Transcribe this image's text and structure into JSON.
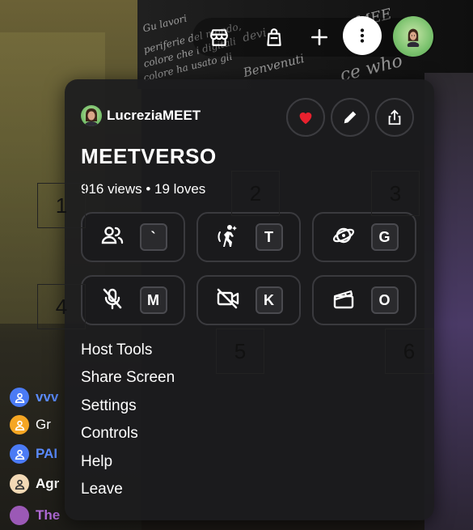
{
  "world": {
    "wall_lines": [
      "Gu lavori",
      "periferie del mondo,",
      "colore che i digitali",
      "colore ha usato gli",
      "devi",
      "Benvenuti",
      "MEE",
      "ce who"
    ]
  },
  "toolbar": {
    "items": [
      {
        "name": "store",
        "icon": "store-icon"
      },
      {
        "name": "bag",
        "icon": "bag-icon"
      },
      {
        "name": "create",
        "icon": "plus-icon"
      },
      {
        "name": "more",
        "icon": "more-vertical-icon"
      },
      {
        "name": "avatar",
        "icon": "user-avatar"
      }
    ]
  },
  "chat": [
    {
      "name": "vvv",
      "color": "#4b7bf5",
      "text_color": "#5b8cff"
    },
    {
      "name": "Gr",
      "color": "#f5a623",
      "text_color": "#ffffff"
    },
    {
      "name": "PAI",
      "color": "#4b7bf5",
      "text_color": "#5b8cff"
    },
    {
      "name": "Agr",
      "color": "#f3d9b5",
      "text_color": "#ffffff"
    },
    {
      "name": "The",
      "color": "#9b59b6",
      "text_color": "#b06ad6"
    }
  ],
  "panel": {
    "author": "LucreziaMEET",
    "title": "MEETVERSO",
    "stats": "916 views • 19 loves",
    "actions": [
      {
        "name": "love",
        "icon": "heart-icon",
        "color": "#e8212e"
      },
      {
        "name": "edit",
        "icon": "pencil-icon"
      },
      {
        "name": "share",
        "icon": "share-icon"
      }
    ],
    "controls": [
      {
        "name": "people",
        "icon": "people-icon",
        "key": "`"
      },
      {
        "name": "emote",
        "icon": "dance-icon",
        "key": "T"
      },
      {
        "name": "teleport",
        "icon": "orbit-icon",
        "key": "G"
      },
      {
        "name": "mute",
        "icon": "mic-off-icon",
        "key": "M"
      },
      {
        "name": "camera",
        "icon": "camera-off-icon",
        "key": "K"
      },
      {
        "name": "clapper",
        "icon": "clapperboard-icon",
        "key": "O"
      }
    ],
    "menu": [
      "Host Tools",
      "Share Screen",
      "Settings",
      "Controls",
      "Help",
      "Leave"
    ]
  },
  "annotations": [
    "1",
    "2",
    "3",
    "4",
    "5",
    "6"
  ]
}
